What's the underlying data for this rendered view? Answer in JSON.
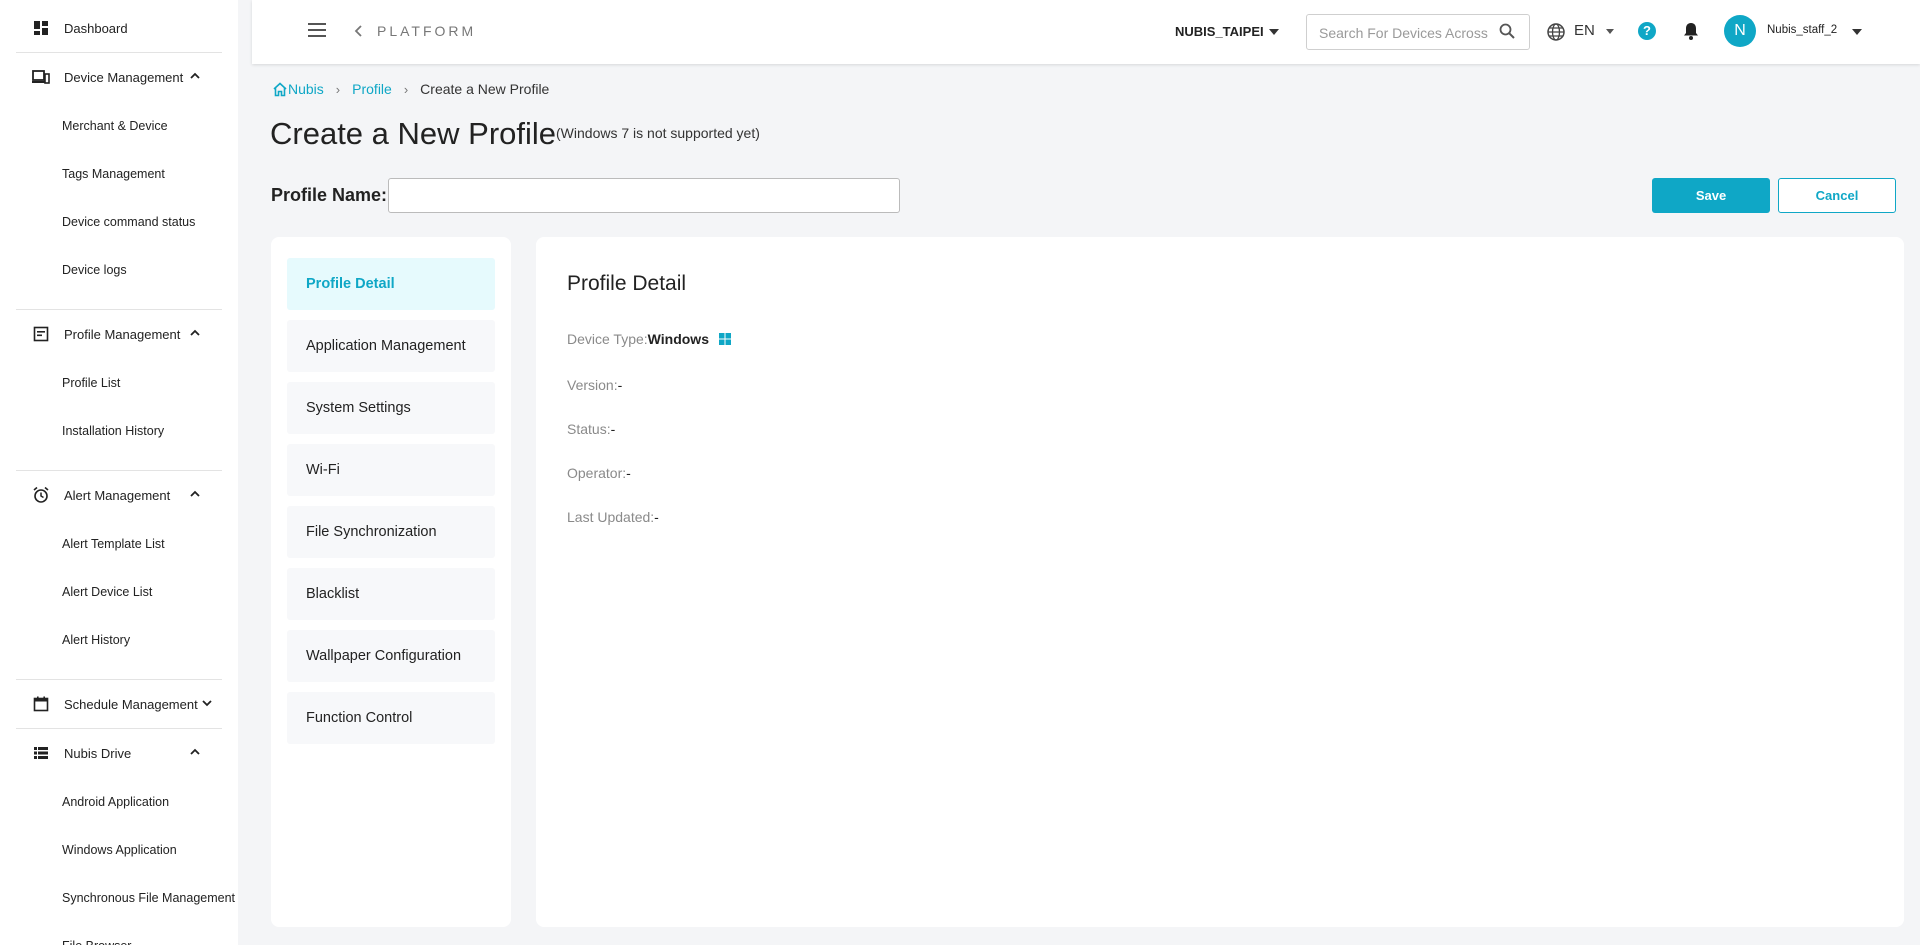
{
  "sidebar": {
    "dashboard": "Dashboard",
    "device_management": {
      "label": "Device Management",
      "items": [
        "Merchant & Device",
        "Tags Management",
        "Device command status",
        "Device logs"
      ]
    },
    "profile_management": {
      "label": "Profile Management",
      "items": [
        "Profile List",
        "Installation History"
      ]
    },
    "alert_management": {
      "label": "Alert Management",
      "items": [
        "Alert Template List",
        "Alert Device List",
        "Alert History"
      ]
    },
    "schedule_management": {
      "label": "Schedule Management"
    },
    "nubis_drive": {
      "label": "Nubis Drive",
      "items": [
        "Android Application",
        "Windows Application",
        "Synchronous File Management",
        "File Browser"
      ]
    }
  },
  "header": {
    "platform": "PLATFORM",
    "organization": "NUBIS_TAIPEI",
    "search_placeholder": "Search For Devices Across",
    "language": "EN",
    "help": "?",
    "avatar_letter": "N",
    "username": "Nubis_staff_2"
  },
  "breadcrumb": {
    "home": "Nubis",
    "profile": "Profile",
    "current": "Create a New Profile"
  },
  "page": {
    "title": "Create a New Profile",
    "note": "(Windows 7 is not supported yet)",
    "profile_name_label": "Profile Name:",
    "profile_name_value": "",
    "save": "Save",
    "cancel": "Cancel"
  },
  "menu": {
    "items": [
      "Profile Detail",
      "Application Management",
      "System Settings",
      "Wi-Fi",
      "File Synchronization",
      "Blacklist",
      "Wallpaper Configuration",
      "Function Control"
    ],
    "active_index": 0
  },
  "detail": {
    "title": "Profile Detail",
    "device_type_label": "Device Type:",
    "device_type_value": "Windows",
    "version_label": "Version:",
    "version_value": "-",
    "status_label": "Status:",
    "status_value": "-",
    "operator_label": "Operator:",
    "operator_value": "-",
    "last_updated_label": "Last Updated:",
    "last_updated_value": "-"
  },
  "colors": {
    "accent": "#0fa7c6",
    "active_menu_bg": "#e6fafd",
    "page_bg": "#f4f5f7"
  }
}
